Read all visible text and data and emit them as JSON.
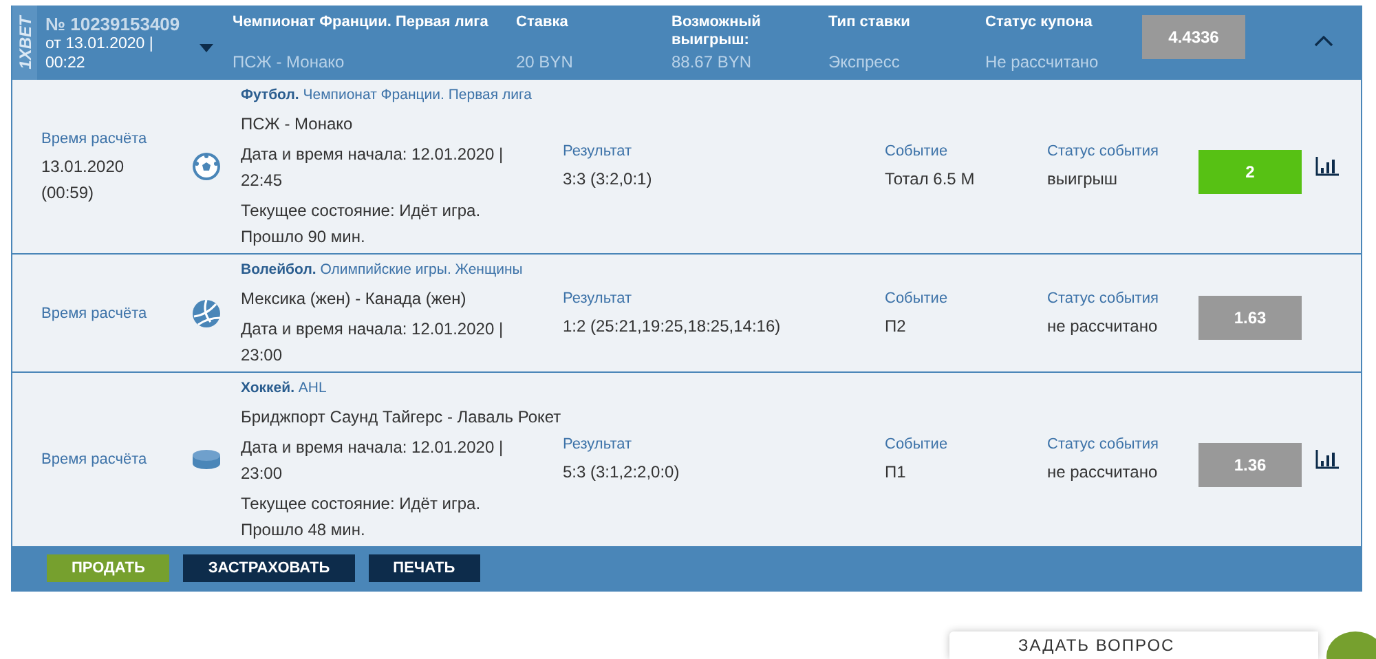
{
  "header": {
    "logo": "1XBET",
    "number": "№ 10239153409",
    "date": "от 13.01.2020 | 00:22",
    "expanded": true,
    "match_title": "Чемпионат Франции. Первая лига",
    "match": "ПСЖ - Монако",
    "fields": [
      {
        "label": "Ставка",
        "value": "20 BYN"
      },
      {
        "label": "Возможный выигрыш:",
        "value": "88.67 BYN"
      },
      {
        "label": "Тип ставки",
        "value": "Экспресс"
      },
      {
        "label": "Статус купона",
        "value": "Не рассчитано"
      }
    ],
    "odds": "4.4336"
  },
  "rows": [
    {
      "time_label": "Время расчёта",
      "time_value": "13.01.2020 (00:59)",
      "kind": "football",
      "category": "**Футбол.** Чемпионат Франции. Первая лига",
      "teams": "ПСЖ - Монако",
      "start": "Дата и время начала: 12.01.2020 | 22:45",
      "state": "Текущее состояние: Идёт игра. Прошло 90 мин.",
      "result_label": "Результат",
      "result": "3:3 (3:2,0:1)",
      "event_label": "Событие",
      "event": "Тотал 6.5 М",
      "status_label": "Статус события",
      "status": "выигрыш",
      "won": true,
      "odds": "2",
      "stats": true
    },
    {
      "time_label": "Время расчёта",
      "kind": "volleyball",
      "category": "**Волейбол.** Олимпийские игры. Женщины",
      "teams": "Мексика (жен) - Канада (жен)",
      "start": "Дата и время начала: 12.01.2020 | 23:00",
      "result_label": "Результат",
      "result": "1:2 (25:21,19:25,18:25,14:16)",
      "event_label": "Событие",
      "event": "П2",
      "status_label": "Статус события",
      "status": "не рассчитано",
      "won": false,
      "odds": "1.63",
      "stats": false
    },
    {
      "time_label": "Время расчёта",
      "kind": "hockey",
      "category": "**Хоккей.** AHL",
      "teams": "Бриджпорт Саунд Тайгерс - Лаваль Рокет",
      "start": "Дата и время начала: 12.01.2020 | 23:00",
      "state": "Текущее состояние: Идёт игра. Прошло 48 мин.",
      "result_label": "Результат",
      "result": "5:3 (3:1,2:2,0:0)",
      "event_label": "Событие",
      "event": "П1",
      "status_label": "Статус события",
      "status": "не рассчитано",
      "won": false,
      "odds": "1.36",
      "stats": true
    }
  ],
  "buttons": [
    {
      "label": "ПРОДАТЬ",
      "kind": "primary"
    },
    {
      "label": "ЗАСТРАХОВАТЬ",
      "kind": "dark"
    },
    {
      "label": "ПЕЧАТЬ",
      "kind": "dark"
    }
  ],
  "ask_widget": {
    "label": "ЗАДАТЬ ВОПРОС"
  }
}
